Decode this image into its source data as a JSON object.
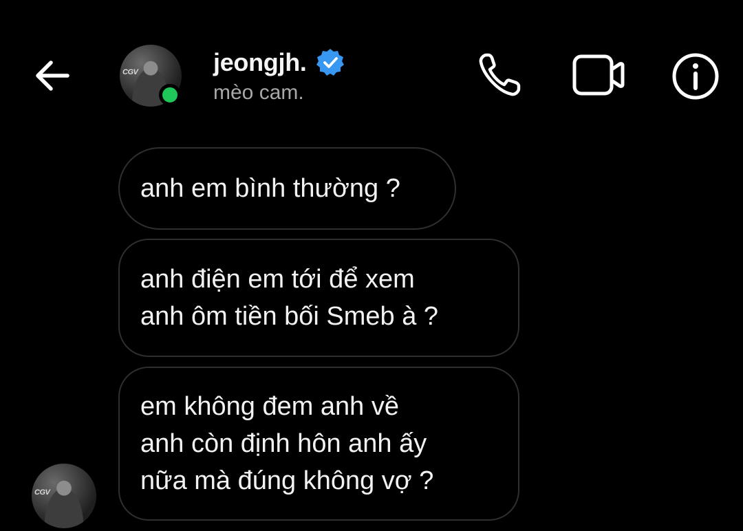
{
  "header": {
    "username": "jeongjh.",
    "subtitle": "mèo cam.",
    "avatar_badge": "CGV",
    "icons": {
      "back": "arrow-left-icon",
      "verified": "verified-badge-icon",
      "phone": "phone-icon",
      "video": "video-camera-icon",
      "info": "info-icon"
    },
    "verified_color": "#3897f0",
    "online_color": "#1fc75a"
  },
  "messages": [
    {
      "text": "anh em bình thường ?"
    },
    {
      "text": "anh điện em tới để xem\nanh ôm tiền bối Smeb à ?"
    },
    {
      "text": "em không đem anh về\nanh còn định hôn anh ấy\nnữa mà đúng không vợ ?"
    }
  ],
  "sender_avatar_badge": "CGV"
}
